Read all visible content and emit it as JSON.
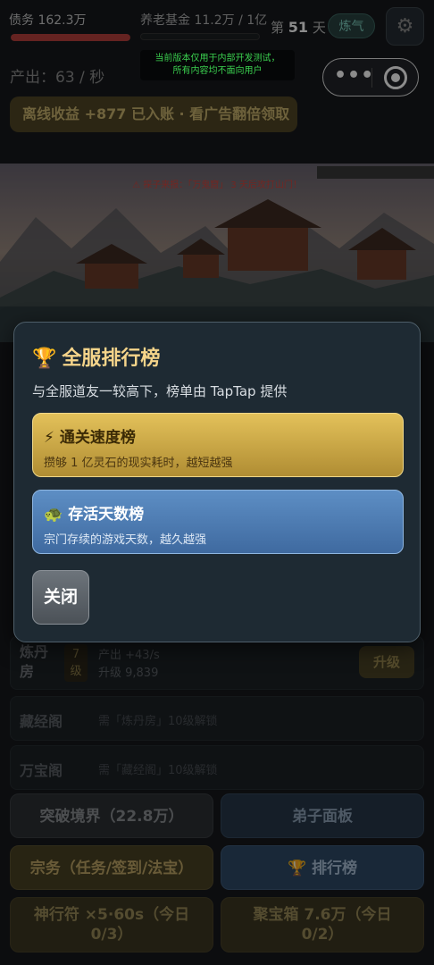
{
  "topbar": {
    "debt": "债务 162.3万",
    "pension": "养老基金 11.2万 / 1亿",
    "day_prefix": "第",
    "day_value": "51",
    "day_suffix": "天",
    "stage_badge": "炼气",
    "dev_notice_line1": "当前版本仅用于内部开发测试，",
    "dev_notice_line2": "所有内容均不面向用户"
  },
  "output_rate": "产出：63 / 秒",
  "offline_banner": "离线收益 +877 已入账 · 看广告翻倍领取",
  "scene": {
    "raid_alert": "⚠ 探子来报：「万鬼窟」 3 天后攻打山门！"
  },
  "buildings": [
    {
      "name_line1": "炼丹",
      "name_line2": "房",
      "level_top": "7",
      "level_bottom": "级",
      "output": "产出 +43/s",
      "upgrade_cost": "升级 9,839",
      "upgrade_label": "升级"
    },
    {
      "name": "藏经阁",
      "requirement": "需「炼丹房」10级解锁"
    },
    {
      "name": "万宝阁",
      "requirement": "需「藏经阁」10级解锁"
    }
  ],
  "bottom_buttons": {
    "breakthrough": "突破境界（22.8万）",
    "disciples": "弟子面板",
    "sect_affairs": "宗务（任务/签到/法宝）",
    "leaderboard": "排行榜",
    "talisman_line1": "神行符 ×5·60s（今日",
    "talisman_line2": "0/3）",
    "treasure_line1": "聚宝箱 7.6万（今日",
    "treasure_line2": "0/2）"
  },
  "modal": {
    "title": "全服排行榜",
    "description": "与全服道友一较高下，榜单由 TapTap 提供",
    "cards": [
      {
        "icon": "⚡",
        "title": "通关速度榜",
        "subtitle": "攒够 1 亿灵石的现实耗时，越短越强"
      },
      {
        "icon": "🐢",
        "title": "存活天数榜",
        "subtitle": "宗门存续的游戏天数，越久越强"
      }
    ],
    "close_label": "关闭"
  },
  "colors": {
    "accent_gold": "#e3c15a",
    "accent_blue": "#5d8ec4",
    "debt_bar": "#b8403c"
  }
}
